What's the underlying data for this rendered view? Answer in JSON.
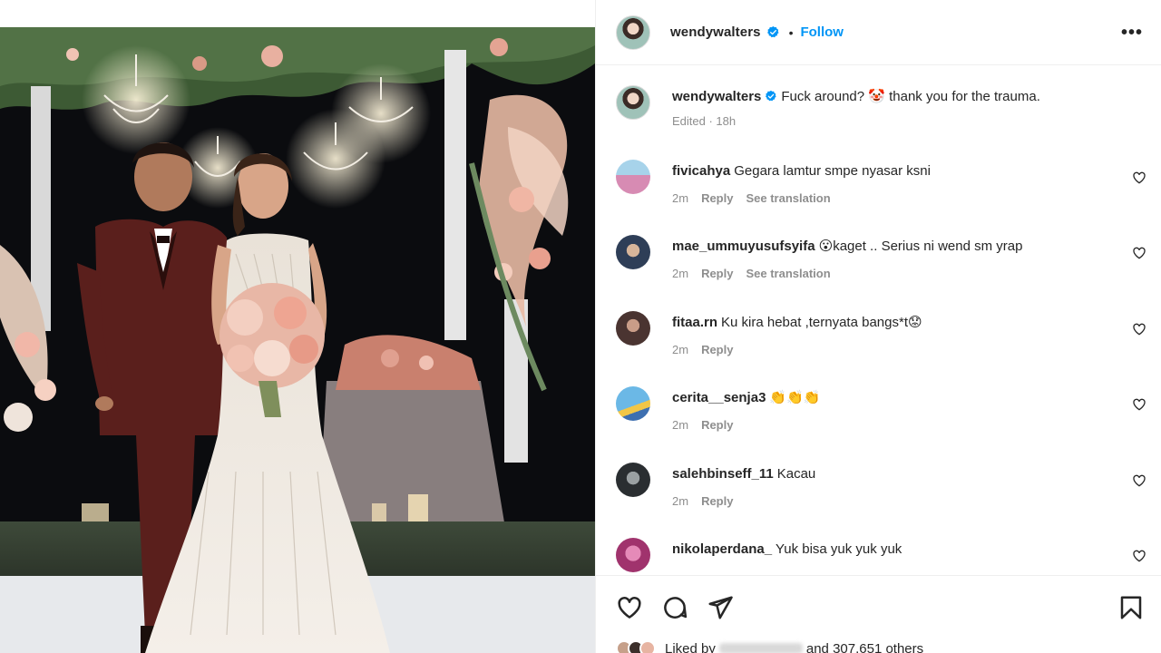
{
  "post": {
    "username": "wendywalters",
    "follow_label": "Follow",
    "separator": "•",
    "more_label": "•••"
  },
  "caption": {
    "username": "wendywalters",
    "text": "Fuck around? 🤡 thank you for the trauma.",
    "meta": "Edited · 18h"
  },
  "comments": [
    {
      "user": "fivicahya",
      "text": "Gegara lamtur smpe nyasar ksni",
      "time": "2m",
      "reply": "Reply",
      "translation": "See translation"
    },
    {
      "user": "mae_ummuyusufsyifa",
      "text": "😮kaget .. Serius ni wend sm yrap",
      "time": "2m",
      "reply": "Reply",
      "translation": "See translation"
    },
    {
      "user": "fitaa.rn",
      "text": "Ku kira hebat ,ternyata bangs*t😟",
      "time": "2m",
      "reply": "Reply"
    },
    {
      "user": "cerita__senja3",
      "text": "👏👏👏",
      "time": "2m",
      "reply": "Reply"
    },
    {
      "user": "salehbinseff_11",
      "text": "Kacau",
      "time": "2m",
      "reply": "Reply"
    },
    {
      "user": "nikolaperdana_",
      "text": "Yuk bisa yuk yuk yuk",
      "time": "",
      "reply": ""
    }
  ],
  "likes": {
    "prefix": "Liked by",
    "suffix": "and 307,651 others"
  },
  "icons": {
    "verified": "verified-badge-icon",
    "like": "heart-icon",
    "comment": "comment-bubble-icon",
    "share": "paper-plane-icon",
    "save": "bookmark-icon",
    "more": "more-options-icon"
  },
  "colors": {
    "accent": "#0095f6",
    "text": "#262626",
    "muted": "#8e8e8e",
    "divider": "#efefef"
  }
}
